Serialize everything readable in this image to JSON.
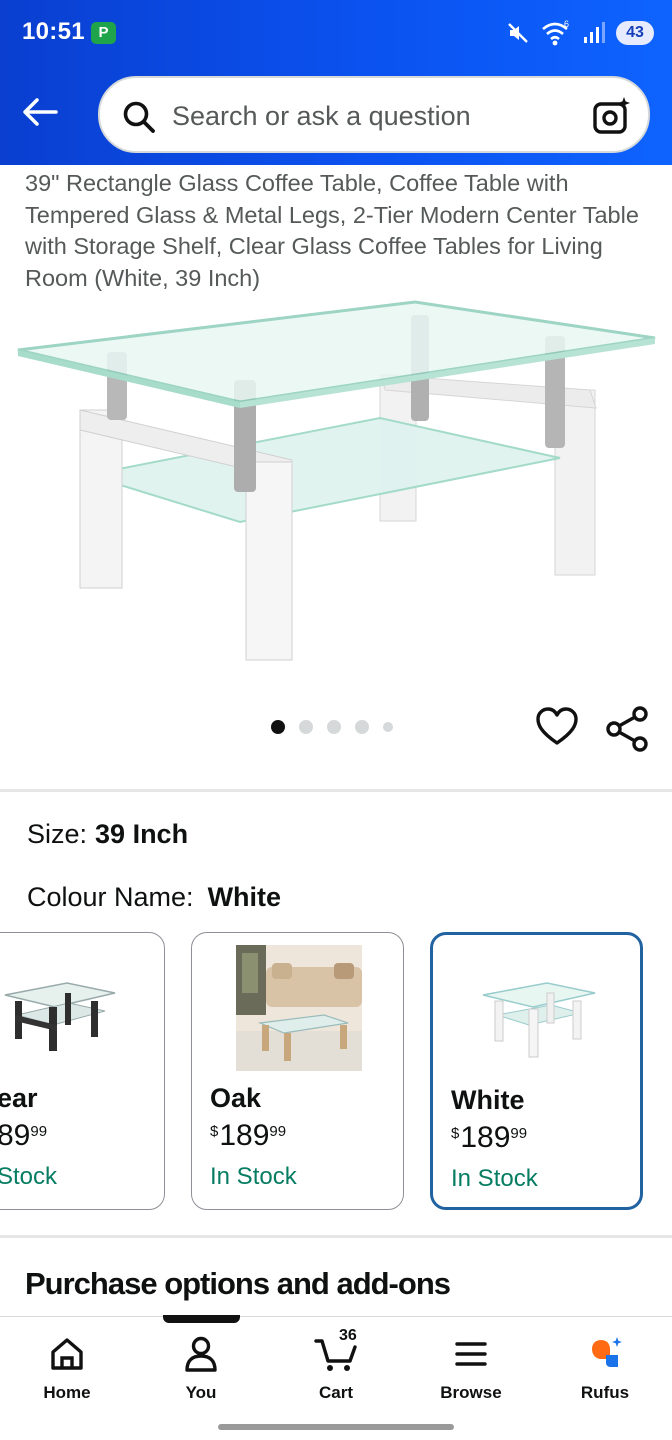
{
  "status_bar": {
    "time": "10:51",
    "app_badge": "P",
    "wifi_label": "6",
    "battery": "43"
  },
  "search": {
    "placeholder": "Search or ask a question"
  },
  "product": {
    "title": "39\" Rectangle Glass Coffee Table, Coffee Table with Tempered Glass & Metal Legs, 2-Tier Modern Center Table with Storage Shelf, Clear Glass Coffee Tables for Living Room (White, 39 Inch)",
    "image_count": 5,
    "active_image": 1
  },
  "variations": {
    "size_label": "Size:",
    "size_value": "39 Inch",
    "colour_label": "Colour Name:",
    "colour_value": "White",
    "options": [
      {
        "name": "ear",
        "price_currency": "",
        "price_whole": "89",
        "price_fraction": "99",
        "stock": "Stock",
        "selected": false
      },
      {
        "name": "Oak",
        "price_currency": "$",
        "price_whole": "189",
        "price_fraction": "99",
        "stock": "In Stock",
        "selected": false
      },
      {
        "name": "White",
        "price_currency": "$",
        "price_whole": "189",
        "price_fraction": "99",
        "stock": "In Stock",
        "selected": true
      }
    ]
  },
  "sections": {
    "purchase_options": "Purchase options and add-ons"
  },
  "bottom_nav": {
    "items": [
      {
        "label": "Home",
        "icon": "home-icon"
      },
      {
        "label": "You",
        "icon": "person-icon"
      },
      {
        "label": "Cart",
        "icon": "cart-icon"
      },
      {
        "label": "Browse",
        "icon": "menu-icon"
      },
      {
        "label": "Rufus",
        "icon": "rufus-icon"
      }
    ],
    "cart_count": "36"
  },
  "colors": {
    "header": "#0b52f0",
    "selected_border": "#2162a1",
    "in_stock": "#067d62",
    "rufus_orange": "#ff6a13",
    "rufus_blue": "#1a73e8"
  }
}
